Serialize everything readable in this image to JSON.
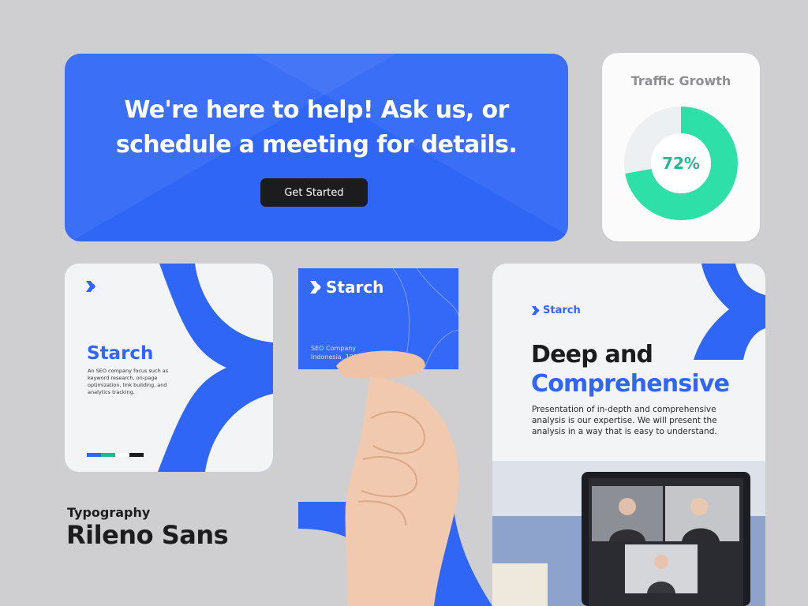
{
  "hero": {
    "title": "We're here to help! Ask us, or\nschedule a meeting for details.",
    "button_label": "Get Started"
  },
  "traffic": {
    "title": "Traffic Growth",
    "value_label": "72%",
    "percent": 72,
    "accent_color": "#2ee0a8"
  },
  "brand_card": {
    "name": "Starch",
    "description": "An SEO company focus such as keyword research, on-page optimization, link building, and analytics tracking.",
    "swatches": [
      "#2f66f5",
      "#22b892",
      "#ffffff",
      "#1c1c1e"
    ]
  },
  "typography": {
    "label": "Typography",
    "font_name": "Rileno Sans"
  },
  "business_card": {
    "brand": "Starch",
    "line1": "SEO Company",
    "line2": "Indonesia, 101"
  },
  "poster": {
    "brand": "Starch",
    "heading_line1": "Deep and",
    "heading_line2": "Comprehensive",
    "body": "Presentation of in-depth and comprehensive analysis is our expertise. We will present the analysis in a way that is easy to understand."
  },
  "colors": {
    "brand_blue": "#2f66f5",
    "background": "#cfcfd1",
    "dark": "#1c1c1e",
    "green": "#22b892"
  }
}
